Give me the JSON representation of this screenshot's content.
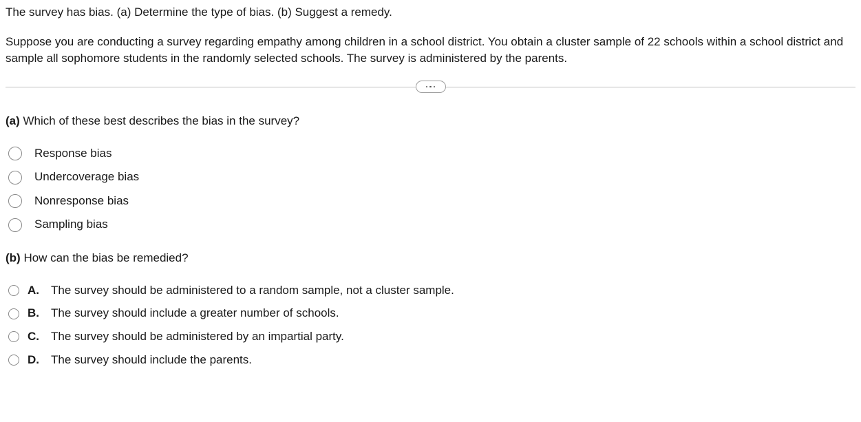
{
  "intro": "The survey has bias. (a) Determine the type of bias. (b) Suggest a remedy.",
  "context": "Suppose you are conducting a survey regarding empathy among children in a school district. You obtain a cluster sample of 22 schools within a school district and sample all sophomore students in the randomly selected schools. The survey is administered by the parents.",
  "qa": {
    "prefix": "(a)",
    "prompt": "Which of these best describes the bias in the survey?",
    "options": [
      {
        "label": "Response bias"
      },
      {
        "label": "Undercoverage bias"
      },
      {
        "label": "Nonresponse bias"
      },
      {
        "label": "Sampling bias"
      }
    ]
  },
  "qb": {
    "prefix": "(b)",
    "prompt": "How can the bias be remedied?",
    "options": [
      {
        "letter": "A.",
        "label": "The survey should be administered to a random sample, not a cluster sample."
      },
      {
        "letter": "B.",
        "label": "The survey should include a greater number of schools."
      },
      {
        "letter": "C.",
        "label": "The survey should be administered by an impartial party."
      },
      {
        "letter": "D.",
        "label": "The survey should include the parents."
      }
    ]
  }
}
